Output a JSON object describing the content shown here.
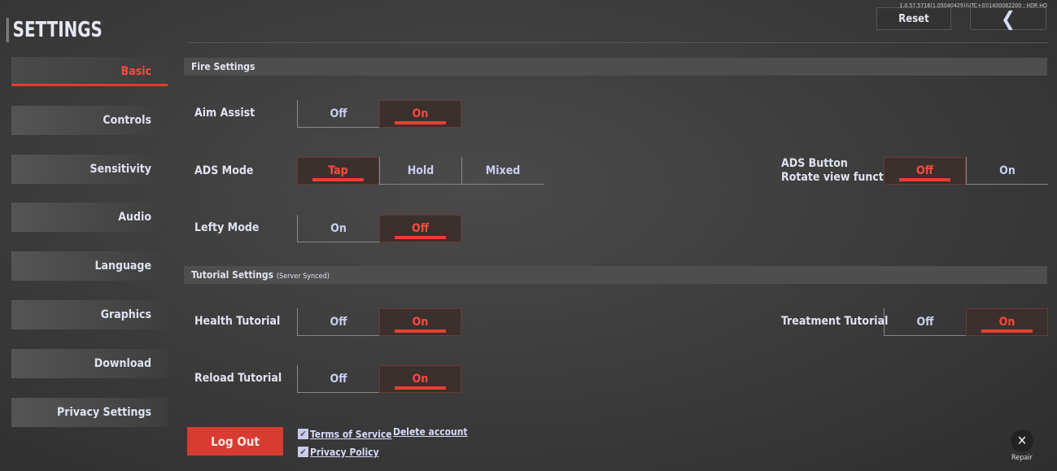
{
  "header": {
    "title": "SETTINGS",
    "version": "1.0.57.5716(1.05040429)(UTC+0)|1400082200 : HDR HQ",
    "reset_label": "Reset",
    "back_icon": "chevron-left-icon"
  },
  "sidebar": {
    "items": [
      {
        "label": "Basic",
        "active": true
      },
      {
        "label": "Controls"
      },
      {
        "label": "Sensitivity"
      },
      {
        "label": "Audio"
      },
      {
        "label": "Language"
      },
      {
        "label": "Graphics"
      },
      {
        "label": "Download"
      },
      {
        "label": "Privacy Settings"
      }
    ]
  },
  "fire": {
    "title": "Fire Settings",
    "aim_assist": {
      "label": "Aim Assist",
      "options": [
        "Off",
        "On"
      ],
      "selected": "On"
    },
    "ads_mode": {
      "label": "ADS Mode",
      "options": [
        "Tap",
        "Hold",
        "Mixed"
      ],
      "selected": "Tap"
    },
    "ads_button": {
      "label1": "ADS Button",
      "label2": "Rotate view function",
      "options": [
        "Off",
        "On"
      ],
      "selected": "Off"
    },
    "lefty": {
      "label": "Lefty Mode",
      "options": [
        "On",
        "Off"
      ],
      "selected": "Off"
    }
  },
  "tutorial": {
    "title": "Tutorial Settings",
    "subtitle": "(Server Synced)",
    "health": {
      "label": "Health Tutorial",
      "options": [
        "Off",
        "On"
      ],
      "selected": "On"
    },
    "treatment": {
      "label": "Treatment Tutorial",
      "options": [
        "Off",
        "On"
      ],
      "selected": "On"
    },
    "reload": {
      "label": "Reload Tutorial",
      "options": [
        "Off",
        "On"
      ],
      "selected": "On"
    }
  },
  "footer": {
    "logout": "Log Out",
    "terms": "Terms of Service",
    "privacy": "Privacy Policy",
    "delete": "Delete account",
    "repair": "Repair",
    "terms_checked": true,
    "privacy_checked": true
  },
  "colors": {
    "accent": "#e84030",
    "logout_bg": "#d83b30"
  }
}
